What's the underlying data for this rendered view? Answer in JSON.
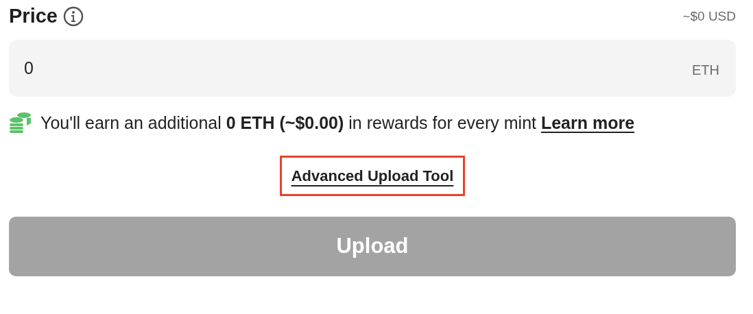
{
  "price": {
    "label": "Price",
    "usd_estimate": "~$0 USD",
    "value": "0",
    "unit": "ETH"
  },
  "reward_note": {
    "text": "You'll earn an additional **0 ETH (~$0.00)** in rewards for every mint",
    "link": "Learn more"
  },
  "advanced_link": {
    "label": "Advanced Upload Tool",
    "highlighted": true
  },
  "upload_button": {
    "label": "Upload",
    "disabled": true
  }
}
